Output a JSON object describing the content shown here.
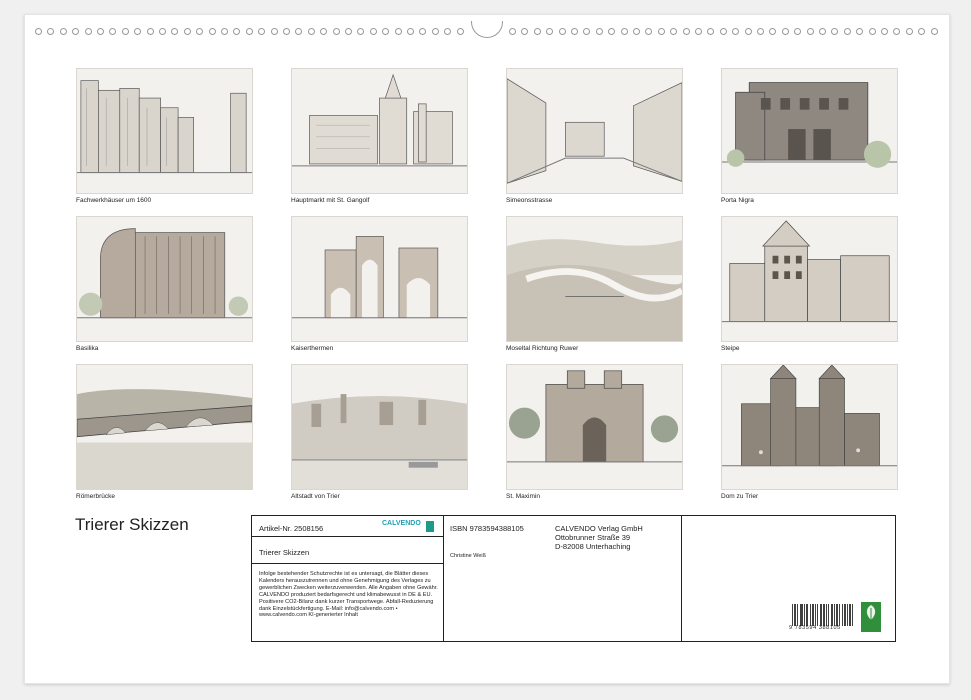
{
  "calendar": {
    "title": "Trierer Skizzen"
  },
  "thumbnails": [
    {
      "caption": "Fachwerkhäuser um 1600"
    },
    {
      "caption": "Hauptmarkt mit St. Gangolf"
    },
    {
      "caption": "Simeonsstrasse"
    },
    {
      "caption": "Porta Nigra"
    },
    {
      "caption": "Basilika"
    },
    {
      "caption": "Kaiserthermen"
    },
    {
      "caption": "Moseltal Richtung Ruwer"
    },
    {
      "caption": "Steipe"
    },
    {
      "caption": "Römerbrücke"
    },
    {
      "caption": "Altstadt von Trier"
    },
    {
      "caption": "St. Maximin"
    },
    {
      "caption": "Dom zu Trier"
    }
  ],
  "info": {
    "article": "Artikel-Nr. 2508156",
    "brand": "CALVENDO",
    "product_title": "Trierer Skizzen",
    "legal": "Infolge bestehender Schutzrechte ist es untersagt, die Blätter dieses Kalenders herauszutrennen und ohne Genehmigung des Verlages zu gewerblichen Zwecken weiterzuverwenden. Alle Angaben ohne Gewähr. CALVENDO produziert bedarfsgerecht und klimabewusst in DE & EU. Positivere CO2-Bilanz dank kurzer Transportwege. Abfall-Reduzierung dank Einzelstückfertigung. E-Mail: info@calvendo.com • www.calvendo.com KI-generierter Inhalt",
    "isbn": "ISBN 9783594388105",
    "author": "Christine Weiß",
    "publisher_name": "CALVENDO Verlag GmbH",
    "publisher_street": "Ottobrunner Straße 39",
    "publisher_city": "D-82008 Unterhaching",
    "barcode_number": "9 783594 388105",
    "fsc": "FSC"
  }
}
